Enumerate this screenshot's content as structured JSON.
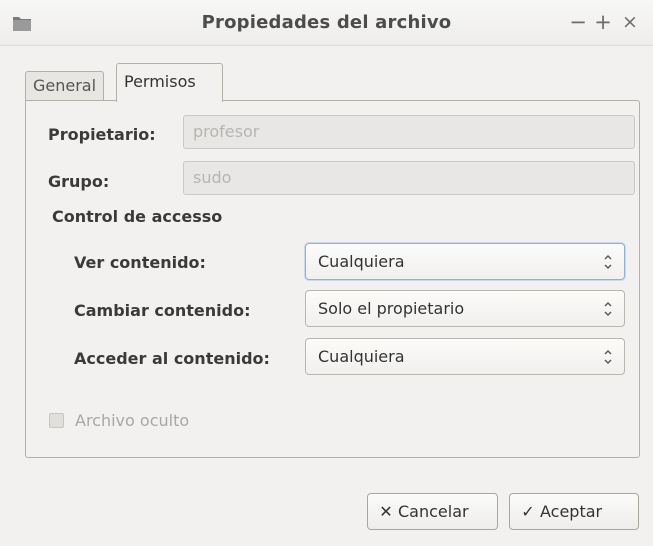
{
  "window": {
    "title": "Propiedades del archivo",
    "icon": "folder-icon",
    "controls": {
      "minimize": "−",
      "maximize": "+",
      "close": "×"
    }
  },
  "tabs": [
    {
      "label": "General",
      "active": false
    },
    {
      "label": "Permisos",
      "active": true
    }
  ],
  "owner": {
    "label": "Propietario:",
    "value": "profesor"
  },
  "group": {
    "label": "Grupo:",
    "value": "sudo"
  },
  "access": {
    "section_title": "Control de accesso",
    "rows": [
      {
        "label": "Ver contenido:",
        "value": "Cualquiera"
      },
      {
        "label": "Cambiar contenido:",
        "value": "Solo el propietario"
      },
      {
        "label": "Acceder al contenido:",
        "value": "Cualquiera"
      }
    ]
  },
  "hidden_file": {
    "label": "Archivo oculto",
    "checked": false,
    "enabled": false
  },
  "buttons": {
    "cancel": {
      "label": "Cancelar",
      "icon": "x-icon"
    },
    "ok": {
      "label": "Aceptar",
      "icon": "check-icon"
    }
  },
  "colors": {
    "background": "#f2f1f0",
    "focus_ring": "#8fb1d9",
    "disabled_text": "#b7b5b1"
  }
}
